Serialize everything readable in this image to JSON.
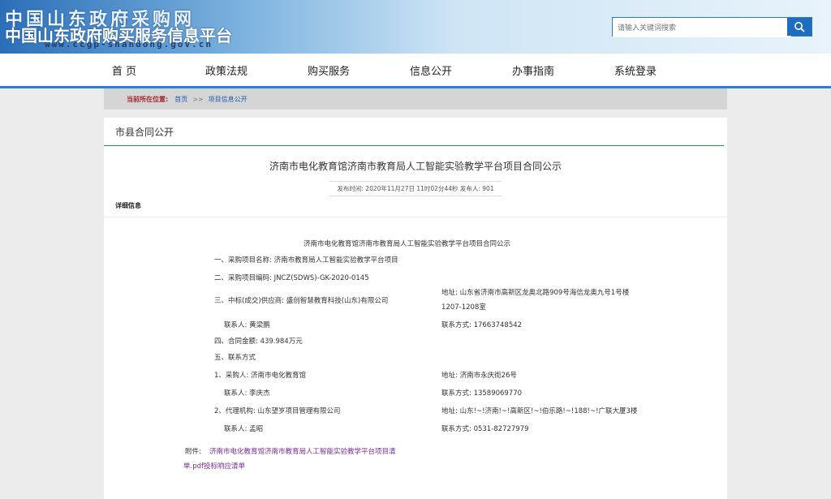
{
  "header": {
    "title_main": "中国山东政府采购网",
    "title_sub": "中国山东政府购买服务信息平台",
    "url": "www.ccgp-shandong.gov.cn",
    "search_placeholder": "请输入关键词搜索"
  },
  "nav": {
    "items": [
      "首  页",
      "政策法规",
      "购买服务",
      "信息公开",
      "办事指南",
      "系统登录"
    ]
  },
  "breadcrumb": {
    "lead": "当前所在位置:",
    "home": "首页",
    "sep": ">>",
    "current": "项目信息公开"
  },
  "main": {
    "section_title": "市县合同公开",
    "doc_title": "济南市电化教育馆济南市教育局人工智能实验教学平台项目合同公示",
    "publish_meta": "发布时间: 2020年11月27日 11时02分44秒   发布人: 901",
    "detail_label": "详细信息",
    "content_title": "济南市电化教育馆济南市教育局人工智能实验教学平台项目合同公示",
    "line1": "一、采购项目名称: 济南市教育局人工智能实验教学平台项目",
    "line2": "二、采购项目编码: JNCZ(SDWS)-GK-2020-0145",
    "line3": "三、中标(成交)供应商: 盛创智慧教育科技(山东)有限公司",
    "line3_addr": "地址: 山东省济南市高新区龙奥北路909号海信龙奥九号1号楼",
    "line3_addr2": "1207-1208室",
    "contact1": "联系人: 黄梁鹏",
    "contact1_phone": "联系方式: 17663748542",
    "line4": "四、合同金额: 439.984万元",
    "line5": "五、联系方式",
    "buyer": "1、采购人: 济南市电化教育馆",
    "buyer_addr": "地址: 济南市永庆街26号",
    "contact2": "联系人: 李庆杰",
    "contact2_phone": "联系方式: 13589069770",
    "agency": "2、代理机构: 山东望岁项目管理有限公司",
    "agency_addr": "地址: 山东!~!济南!~!高新区!~!伯乐路!~!188!~!广联大厦3楼",
    "contact3": "联系人: 孟昭",
    "contact3_phone": "联系方式: 0531-82727979",
    "attach_label": "附件:",
    "attach_link1": "济南市电化教育馆济南市教育局人工智能实验教学平台项目清",
    "attach_link2": "单.pdf投标响应清单"
  }
}
